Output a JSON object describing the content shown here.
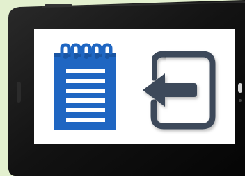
{
  "scene": {
    "description_colors": {
      "background": "#e3f0cf",
      "bezel": "#1a1a1a",
      "screen": "#ffffff",
      "notepad_blue": "#1f66c2",
      "notepad_lines": "#ffffff",
      "signout_stroke": "#3d4a5a"
    },
    "icons": [
      {
        "name": "notepad-icon"
      },
      {
        "name": "sign-in-arrow-icon"
      }
    ]
  }
}
